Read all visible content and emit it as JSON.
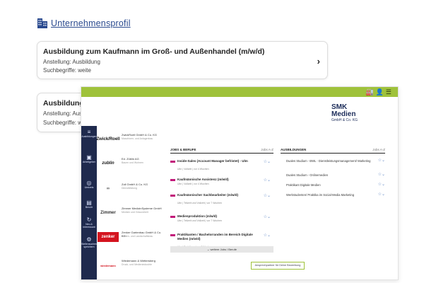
{
  "header": {
    "company_profile_link": "Unternehmensprofil"
  },
  "cards": [
    {
      "title": "Ausbildung zum Kaufmann im Groß- und Außenhandel (m/w/d)",
      "employment": "Anstellung: Ausbildung",
      "keywords": "Suchbegriffe:  weite"
    },
    {
      "title": "Ausbildung zur Fachkraft für Lagerlogistik (m/w/d)",
      "employment": "Anstellung: Ausbildung",
      "keywords": "Suchbegriffe:  weite"
    }
  ],
  "embedded": {
    "brand_big": "SMK\nMedien",
    "brand_small": "GmbH & Co. KG",
    "nav": [
      "Ausbildungen",
      "Arbeitgeber",
      "Umkreis",
      "Berufe",
      "Neu & Interessant",
      "Stellensuchende speichern"
    ],
    "companies": [
      {
        "logo": "Zwick/Roell",
        "name": "ZwickRoell GmbH & Co. KG",
        "sub": "Maschinen- und Anlagenbau"
      },
      {
        "logo": "zublin",
        "name": "Ed. Züblin AG",
        "sub": "Bauen und Wohnen"
      },
      {
        "logo": "∞",
        "name": "Zoll GmbH & Co. KG",
        "sub": "Dienstleistung"
      },
      {
        "logo": "Zimmer",
        "name": "Zimmer MedizinSysteme GmbH",
        "sub": "Medizin und Gesundheit"
      },
      {
        "logo": "zenker",
        "name": "Zenker Gartenbau GmbH & Co. KG",
        "sub": "Garten- und Landschaftsbau"
      },
      {
        "logo": "wiedemann",
        "name": "Wiedemann & Wettersberg",
        "sub": "Druck- und Medienindustrie"
      }
    ],
    "jobs_header": "JOBS & BERUFE",
    "jobs_sort": "Jobs A-Z",
    "jobs": [
      {
        "title": "Inside-Sales (Account Manager befristet) - Ulm",
        "meta": "Ulm | Vollzeit | vor 4 Wochen"
      },
      {
        "title": "Kaufmännische Assistenz (m/w/d)",
        "meta": "Ulm | Vollzeit | vor 4 Wochen"
      },
      {
        "title": "Kaufmännischer Sachbearbeiter (m/w/d)",
        "meta": "Ulm | Teilzeit und Vollzeit | vor 7 Wochen"
      },
      {
        "title": "Medienproduktion (m/w/d)",
        "meta": "Ulm | Teilzeit und Vollzeit | vor 7 Wochen"
      },
      {
        "title": "Praktikanten / Bachelorranden im Bereich Digitale Medien (m/w/d)",
        "meta": "Ulm | Praktikum | vor 7 Wochen"
      }
    ],
    "more_jobs": "weitere Jobs / Berufe",
    "trainings_header": "AUSBILDUNGEN",
    "trainings_sort": "Jobs A-Z",
    "trainings": [
      "Duales Studium - BWL - Dienstleistungsmanagement/ Marketing",
      "Duales Studium - Onlinemedien",
      "Praktikant Digitale Medien",
      "Werkstudenten/ Praktika im Social-Media Marketing"
    ],
    "apply_button": "Ansprechpartner für Deine Bewerbung"
  }
}
